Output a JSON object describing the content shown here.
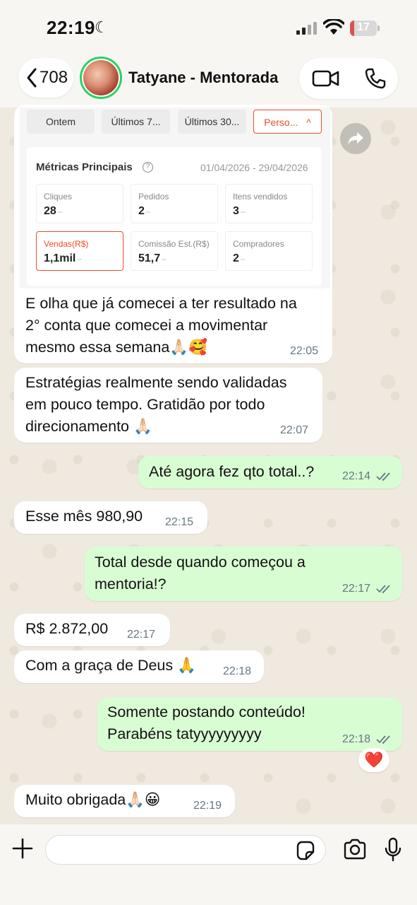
{
  "status_bar": {
    "time": "22:19",
    "battery": "17",
    "battery_level": 0.17
  },
  "header": {
    "back_count": "708",
    "contact_name": "Tatyane - Mentorada"
  },
  "screenshot_card": {
    "filters": [
      "Ontem",
      "Últimos 7...",
      "Últimos 30...",
      "Perso..."
    ],
    "title": "Métricas Principais",
    "help": "?",
    "date_range": "01/04/2026 - 29/04/2026",
    "metrics": [
      {
        "label": "Cliques",
        "value": "28",
        "dash": "–"
      },
      {
        "label": "Pedidos",
        "value": "2",
        "dash": "–"
      },
      {
        "label": "Itens vendidos",
        "value": "3",
        "dash": "–"
      },
      {
        "label": "Vendas(R$)",
        "value": "1,1mil",
        "dash": "–"
      },
      {
        "label": "Comissão Est.(R$)",
        "value": "51,7",
        "dash": "–"
      },
      {
        "label": "Compradores",
        "value": "2",
        "dash": "–"
      }
    ]
  },
  "messages": [
    {
      "dir": "in",
      "lines": [
        "E olha que já comecei a ter resultado na",
        "2° conta que comecei a movimentar",
        "mesmo essa semana🙏🏻🥰"
      ],
      "time": "22:05"
    },
    {
      "dir": "in",
      "lines": [
        "Estratégias realmente sendo validadas",
        "em pouco tempo. Gratidão por todo",
        "direcionamento 🙏🏻"
      ],
      "time": "22:07"
    },
    {
      "dir": "out",
      "lines": [
        "Até agora fez qto total..?"
      ],
      "time": "22:14"
    },
    {
      "dir": "in",
      "lines": [
        "Esse mês 980,90"
      ],
      "time": "22:15"
    },
    {
      "dir": "out",
      "lines": [
        "Total desde quando começou a",
        "mentoria!?"
      ],
      "time": "22:17"
    },
    {
      "dir": "in",
      "lines": [
        "R$ 2.872,00"
      ],
      "time": "22:17"
    },
    {
      "dir": "in",
      "lines": [
        "Com a graça de Deus 🙏"
      ],
      "time": "22:18"
    },
    {
      "dir": "out",
      "lines": [
        "Somente postando conteúdo!",
        "Parabéns tatyyyyyyyyy"
      ],
      "time": "22:18"
    },
    {
      "dir": "in",
      "lines": [
        "Muito obrigada🙏🏻😀"
      ],
      "time": "22:19"
    }
  ],
  "reaction": "❤️",
  "icons": {
    "back": "chevron-left-icon",
    "video": "video-camera-icon",
    "phone": "phone-icon",
    "forward": "forward-icon",
    "plus": "plus-icon",
    "sticker": "sticker-icon",
    "camera": "camera-icon",
    "mic": "microphone-icon"
  },
  "colors": {
    "outgoing_bubble": "#d9fdd3",
    "incoming_bubble": "#ffffff",
    "accent_green": "#25d366",
    "shopee_orange": "#ee4d2d",
    "battery_low": "#d9534f"
  }
}
